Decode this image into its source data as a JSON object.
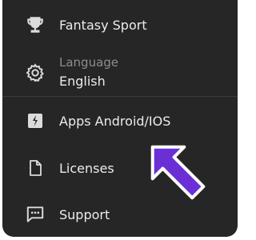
{
  "menu": {
    "items": [
      {
        "label": "Fantasy Sport",
        "icon": "trophy-icon"
      },
      {
        "sublabel": "Language",
        "label": "English",
        "icon": "gear-icon"
      },
      {
        "label": "Apps Android/IOS",
        "icon": "app-icon"
      },
      {
        "label": "Licenses",
        "icon": "document-icon"
      },
      {
        "label": "Support",
        "icon": "chat-icon"
      }
    ]
  },
  "colors": {
    "background": "#262626",
    "text": "#ececec",
    "subtext": "#8d8d8d",
    "icon": "#dcdcdc",
    "arrow": "#6b2fd6"
  }
}
